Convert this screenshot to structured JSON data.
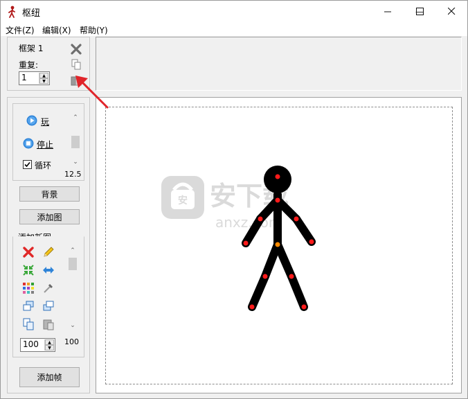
{
  "window": {
    "title": "枢纽",
    "minimize": "—",
    "maximize": "☐",
    "close": "✕"
  },
  "menu": [
    "文件(Z)",
    "编辑(X)",
    "帮助(Y)"
  ],
  "frame_panel": {
    "frame_name": "框架 1",
    "repeat_label": "重复:",
    "repeat_value": "1"
  },
  "playback": {
    "play_label": "玩",
    "stop_label": "停止",
    "loop_label": "循环",
    "loop_checked": true,
    "speed_value": "12.5"
  },
  "buttons": {
    "background": "背景",
    "add_image": "添加图",
    "add_frame": "添加帧"
  },
  "new_figure": {
    "section_label": "添加新图",
    "size_value": "100",
    "size_readout": "100"
  },
  "watermark": {
    "brand": "安下载",
    "domain": "anxz.com"
  },
  "colors": {
    "joint_red": "#ff1a1a",
    "joint_orange": "#ff8a00",
    "figure": "#000000",
    "arrow": "#e0242a"
  }
}
